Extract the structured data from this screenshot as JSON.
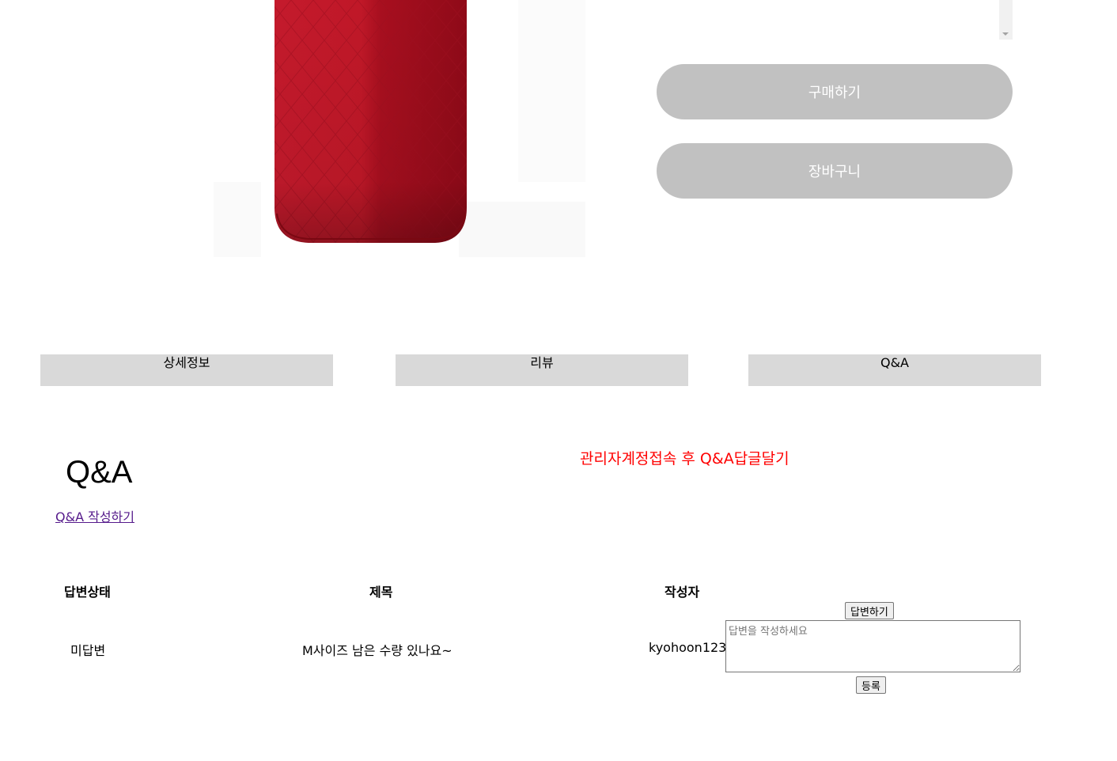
{
  "product": {
    "buy_label": "구매하기",
    "cart_label": "장바구니",
    "button_color": "#c1c1c1"
  },
  "tabs": [
    {
      "label": "상세정보"
    },
    {
      "label": "리뷰"
    },
    {
      "label": "Q&A"
    }
  ],
  "qa": {
    "title": "Q&A",
    "admin_note": "관리자계정접속 후 Q&A답글달기",
    "write_link": "Q&A 작성하기",
    "headers": {
      "status": "답변상태",
      "subject": "제목",
      "author": "작성자"
    },
    "rows": [
      {
        "status": "미답변",
        "subject": "M사이즈 남은 수량 있나요~",
        "author": "kyohoon123",
        "answer_button": "답변하기",
        "answer_placeholder": "답변을 작성하세요",
        "submit_button": "등록"
      }
    ]
  }
}
